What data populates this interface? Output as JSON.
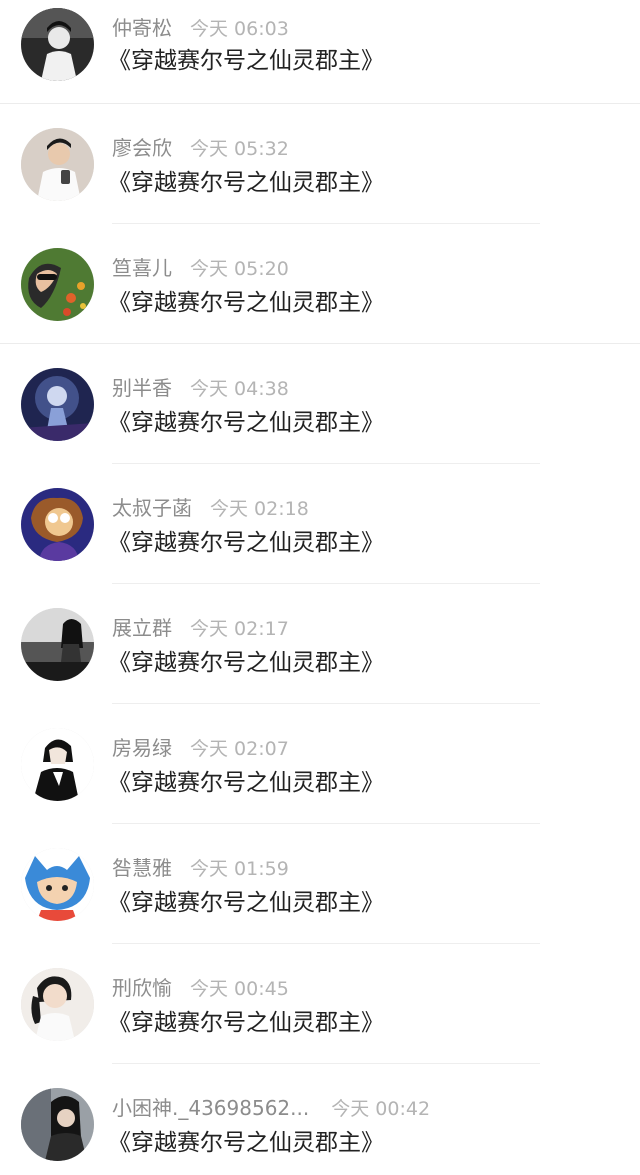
{
  "items": [
    {
      "name": "仲寄松",
      "time": "今天 06:03",
      "text": "《穿越赛尔号之仙灵郡主》",
      "avatar_icon": "avatar-boy-black-white",
      "avatar_color": "#3a3a3a"
    },
    {
      "name": "廖会欣",
      "time": "今天 05:32",
      "text": "《穿越赛尔号之仙灵郡主》",
      "avatar_icon": "avatar-boy-phone",
      "avatar_color": "#cbbfb5"
    },
    {
      "name": "笪喜儿",
      "time": "今天 05:20",
      "text": "《穿越赛尔号之仙灵郡主》",
      "avatar_icon": "avatar-girl-sunglasses-flowers",
      "avatar_color": "#5a7a3a"
    },
    {
      "name": "别半香",
      "time": "今天 04:38",
      "text": "《穿越赛尔号之仙灵郡主》",
      "avatar_icon": "avatar-blue-figure",
      "avatar_color": "#27305a"
    },
    {
      "name": "太叔子菡",
      "time": "今天 02:18",
      "text": "《穿越赛尔号之仙灵郡主》",
      "avatar_icon": "avatar-cartoon-chipmunk",
      "avatar_color": "#2b2a7a"
    },
    {
      "name": "展立群",
      "time": "今天 02:17",
      "text": "《穿越赛尔号之仙灵郡主》",
      "avatar_icon": "avatar-girl-landscape",
      "avatar_color": "#6a6a6a"
    },
    {
      "name": "房易绿",
      "time": "今天 02:07",
      "text": "《穿越赛尔号之仙灵郡主》",
      "avatar_icon": "avatar-anime-boy-suit",
      "avatar_color": "#f2f2f2"
    },
    {
      "name": "咎慧雅",
      "time": "今天 01:59",
      "text": "《穿越赛尔号之仙灵郡主》",
      "avatar_icon": "avatar-stitch-hood",
      "avatar_color": "#f5f5f5"
    },
    {
      "name": "刑欣愉",
      "time": "今天 00:45",
      "text": "《穿越赛尔号之仙灵郡主》",
      "avatar_icon": "avatar-girl-ponytail",
      "avatar_color": "#e9e4df"
    },
    {
      "name": "小困神._43698562...",
      "time": "今天 00:42",
      "text": "《穿越赛尔号之仙灵郡主》",
      "avatar_icon": "avatar-girl-dark-hair",
      "avatar_color": "#8a8f94"
    }
  ]
}
